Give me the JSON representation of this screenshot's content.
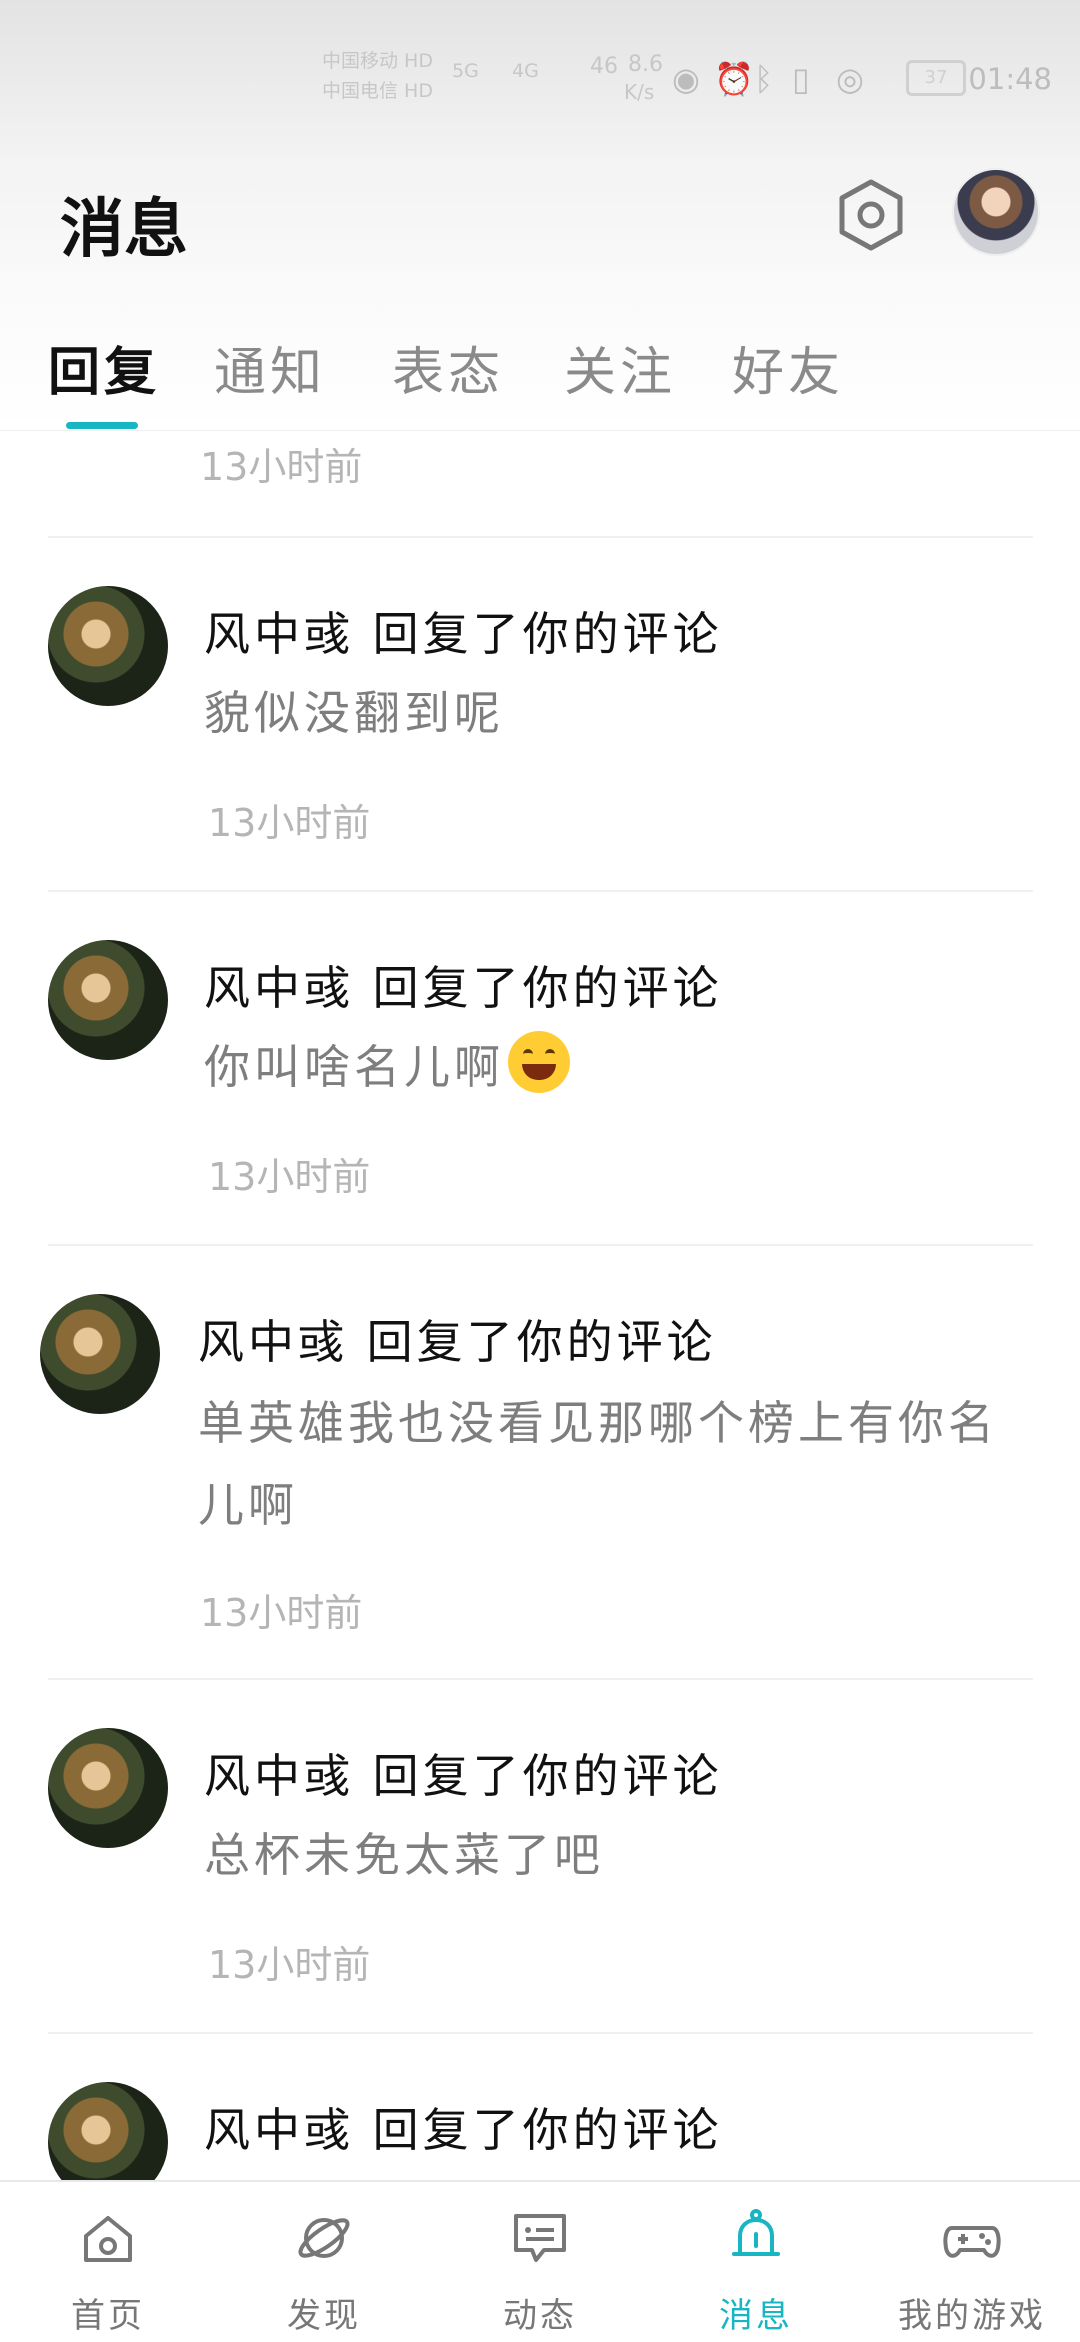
{
  "status_bar": {
    "carrier_1": "中国移动 HD",
    "carrier_2": "中国电信 HD",
    "network_1": "5G",
    "network_2": "4G",
    "speed_value": "8.6",
    "speed_unit": "K/s",
    "speed_prefix": "46",
    "battery": "37",
    "time": "01:48"
  },
  "header": {
    "title": "消息"
  },
  "tabs": [
    {
      "label": "回复",
      "active": true
    },
    {
      "label": "通知",
      "active": false
    },
    {
      "label": "表态",
      "active": false
    },
    {
      "label": "关注",
      "active": false
    },
    {
      "label": "好友",
      "active": false
    }
  ],
  "partial_top_item": {
    "time": "13小时前"
  },
  "messages": [
    {
      "title": "风中彧 回复了你的评论",
      "body": "貌似没翻到呢",
      "time": "13小时前",
      "emoji": false
    },
    {
      "title": "风中彧 回复了你的评论",
      "body": "你叫啥名儿啊",
      "time": "13小时前",
      "emoji": true
    },
    {
      "title": "风中彧 回复了你的评论",
      "body": "单英雄我也没看见那哪个榜上有你名儿啊",
      "time": "13小时前",
      "emoji": false
    },
    {
      "title": "风中彧 回复了你的评论",
      "body": "总杯未免太菜了吧",
      "time": "13小时前",
      "emoji": false
    },
    {
      "title": "风中彧 回复了你的评论",
      "body": "",
      "time": "",
      "emoji": false
    }
  ],
  "bottom_nav": [
    {
      "label": "首页",
      "icon": "home-icon",
      "active": false
    },
    {
      "label": "发现",
      "icon": "planet-icon",
      "active": false
    },
    {
      "label": "动态",
      "icon": "chat-icon",
      "active": false
    },
    {
      "label": "消息",
      "icon": "bell-icon",
      "active": true
    },
    {
      "label": "我的游戏",
      "icon": "gamepad-icon",
      "active": false
    }
  ],
  "colors": {
    "accent": "#18b6c3",
    "title_text": "#111111",
    "body_text": "#7e7e7e",
    "meta_text": "#b5b5b5"
  }
}
